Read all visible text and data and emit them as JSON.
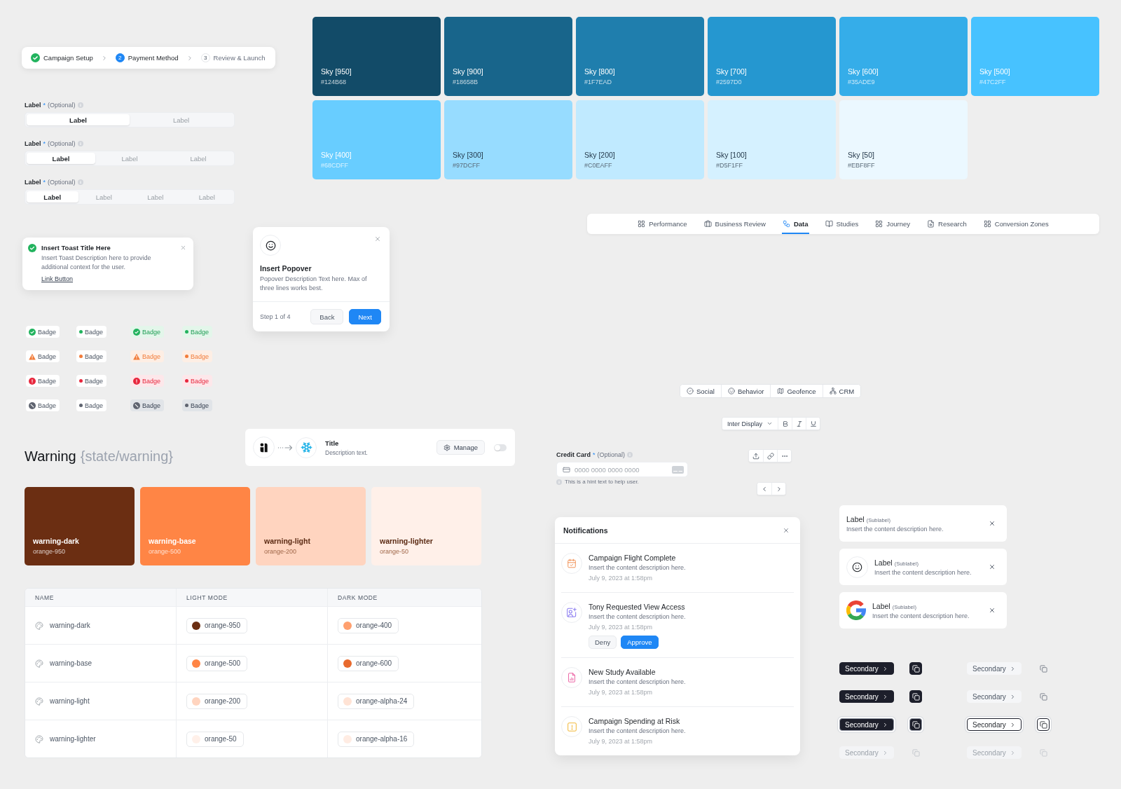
{
  "stepper": {
    "steps": [
      {
        "label": "Campaign Setup",
        "completed": true,
        "selected": false
      },
      {
        "number": "2",
        "label": "Payment Method",
        "completed": false,
        "selected": true
      },
      {
        "number": "3",
        "label": "Review & Launch",
        "completed": false,
        "selected": false
      }
    ]
  },
  "segmented_controls": [
    {
      "label": "Label",
      "required_mark": "*",
      "optional": "(Optional)",
      "options": [
        {
          "label": "Label",
          "selected": true
        },
        {
          "label": "Label",
          "selected": false
        }
      ]
    },
    {
      "label": "Label",
      "required_mark": "*",
      "optional": "(Optional)",
      "options": [
        {
          "label": "Label",
          "selected": true
        },
        {
          "label": "Label",
          "selected": false
        },
        {
          "label": "Label",
          "selected": false
        }
      ]
    },
    {
      "label": "Label",
      "required_mark": "*",
      "optional": "(Optional)",
      "options": [
        {
          "label": "Label",
          "selected": true
        },
        {
          "label": "Label",
          "selected": false
        },
        {
          "label": "Label",
          "selected": false
        },
        {
          "label": "Label",
          "selected": false
        }
      ]
    }
  ],
  "toast": {
    "kind": "success",
    "title": "Insert Toast Title Here",
    "description": "Insert Toast Description here to provide additional context for the user.",
    "link": "Link Button"
  },
  "popover": {
    "title": "Insert Popover",
    "description": "Popover Description Text here. Max of three lines works best.",
    "step": "Step 1 of 4",
    "buttons": [
      {
        "label": "Back",
        "kind": "secondary"
      },
      {
        "label": "Next",
        "kind": "primary"
      }
    ]
  },
  "badge_rows": [
    {
      "kind": "success",
      "badges": [
        {
          "label": "Badge",
          "kind": "icon",
          "tinted": false
        },
        {
          "label": "Badge",
          "kind": "dot",
          "tinted": false
        },
        {
          "label": "Badge",
          "kind": "icon",
          "tinted": true
        },
        {
          "label": "Badge",
          "kind": "dot",
          "tinted": true
        }
      ]
    },
    {
      "kind": "warning",
      "badges": [
        {
          "label": "Badge",
          "kind": "icon",
          "tinted": false
        },
        {
          "label": "Badge",
          "kind": "dot",
          "tinted": false
        },
        {
          "label": "Badge",
          "kind": "icon",
          "tinted": true
        },
        {
          "label": "Badge",
          "kind": "dot",
          "tinted": true
        }
      ]
    },
    {
      "kind": "error",
      "badges": [
        {
          "label": "Badge",
          "kind": "icon",
          "tinted": false
        },
        {
          "label": "Badge",
          "kind": "dot",
          "tinted": false
        },
        {
          "label": "Badge",
          "kind": "icon",
          "tinted": true
        },
        {
          "label": "Badge",
          "kind": "dot",
          "tinted": true
        }
      ]
    },
    {
      "kind": "neutral",
      "badges": [
        {
          "label": "Badge",
          "kind": "icon",
          "tinted": false
        },
        {
          "label": "Badge",
          "kind": "dot",
          "tinted": false
        },
        {
          "label": "Badge",
          "kind": "icon",
          "tinted": true
        },
        {
          "label": "Badge",
          "kind": "dot",
          "tinted": true
        }
      ]
    }
  ],
  "warning": {
    "title": "Warning",
    "token": "{state/warning}",
    "swatches": [
      {
        "name": "warning-dark",
        "token": "orange-950",
        "color": "#6b2e12"
      },
      {
        "name": "warning-base",
        "token": "orange-500",
        "color": "#ff8545"
      },
      {
        "name": "warning-light",
        "token": "orange-200",
        "color": "#ffd4bf"
      },
      {
        "name": "warning-lighter",
        "token": "orange-50",
        "color": "#fff0e9"
      }
    ],
    "table": {
      "columns": [
        "NAME",
        "LIGHT MODE",
        "DARK MODE"
      ],
      "rows": [
        {
          "name": "warning-dark",
          "light": {
            "token": "orange-950",
            "color": "#6b2e12"
          },
          "dark": {
            "token": "orange-400",
            "color": "#ffa06f"
          }
        },
        {
          "name": "warning-base",
          "light": {
            "token": "orange-500",
            "color": "#ff8545"
          },
          "dark": {
            "token": "orange-600",
            "color": "#e86a2e"
          }
        },
        {
          "name": "warning-light",
          "light": {
            "token": "orange-200",
            "color": "#ffd4bf"
          },
          "dark": {
            "token": "orange-alpha-24",
            "color": "#ffe3d5"
          }
        },
        {
          "name": "warning-lighter",
          "light": {
            "token": "orange-50",
            "color": "#fff0e9"
          },
          "dark": {
            "token": "orange-alpha-16",
            "color": "#ffece3"
          }
        }
      ]
    }
  },
  "integration_card": {
    "title": "Title",
    "description": "Description text.",
    "button": "Manage",
    "on": false
  },
  "sky_palette": [
    {
      "name": "Sky [950]",
      "hex": "#124B68",
      "color": "#124b68"
    },
    {
      "name": "Sky [900]",
      "hex": "#18658B",
      "color": "#18658b"
    },
    {
      "name": "Sky [800]",
      "hex": "#1F7EAD",
      "color": "#1f7ead"
    },
    {
      "name": "Sky [700]",
      "hex": "#2597D0",
      "color": "#2597d0"
    },
    {
      "name": "Sky [600]",
      "hex": "#35ADE9",
      "color": "#35ade9"
    },
    {
      "name": "Sky [500]",
      "hex": "#47C2FF",
      "color": "#47c2ff"
    },
    {
      "name": "Sky [400]",
      "hex": "#68CDFF",
      "color": "#68cdff"
    },
    {
      "name": "Sky [300]",
      "hex": "#97DCFF",
      "color": "#97dcff"
    },
    {
      "name": "Sky [200]",
      "hex": "#C0EAFF",
      "color": "#c0eaff"
    },
    {
      "name": "Sky [100]",
      "hex": "#D5F1FF",
      "color": "#d5f1ff"
    },
    {
      "name": "Sky [50]",
      "hex": "#EBF8FF",
      "color": "#ebf8ff"
    }
  ],
  "nav_tabs": [
    {
      "label": "Performance",
      "selected": false
    },
    {
      "label": "Business Review",
      "selected": false
    },
    {
      "label": "Data",
      "selected": true
    },
    {
      "label": "Studies",
      "selected": false
    },
    {
      "label": "Journey",
      "selected": false
    },
    {
      "label": "Research",
      "selected": false
    },
    {
      "label": "Conversion Zones",
      "selected": false
    }
  ],
  "filter_tabs": [
    {
      "label": "Social",
      "selected": false
    },
    {
      "label": "Behavior",
      "selected": false
    },
    {
      "label": "Geofence",
      "selected": false
    },
    {
      "label": "CRM",
      "selected": false
    }
  ],
  "text_toolbar": {
    "font": "Inter Display"
  },
  "credit_card_field": {
    "label": "Credit Card",
    "required_mark": "*",
    "optional": "(Optional)",
    "placeholder": "0000 0000 0000 0000",
    "hint": "This is a hint text to help user."
  },
  "notifications": {
    "title": "Notifications",
    "items": [
      {
        "title": "Campaign Flight Complete",
        "description": "Insert the content description here.",
        "time": "July 9, 2023 at 1:58pm"
      },
      {
        "title": "Tony Requested View Access",
        "description": "Insert the content description here.",
        "time": "July 9, 2023 at 1:58pm",
        "actions": [
          {
            "label": "Deny",
            "kind": "secondary"
          },
          {
            "label": "Approve",
            "kind": "primary"
          }
        ]
      },
      {
        "title": "New Study Available",
        "description": "Insert the content description here.",
        "time": "July 9, 2023 at 1:58pm"
      },
      {
        "title": "Campaign Spending at Risk",
        "description": "Insert the content description here.",
        "time": "July 9, 2023 at 1:58pm"
      }
    ]
  },
  "list_cards": [
    {
      "kind": "plain",
      "label": "Label",
      "sublabel": "(Sublabel)",
      "description": "Insert the content description here."
    },
    {
      "kind": "icon",
      "label": "Label",
      "sublabel": "(Sublabel)",
      "description": "Insert the content description here."
    },
    {
      "kind": "logo",
      "label": "Label",
      "sublabel": "(Sublabel)",
      "description": "Insert the content description here."
    }
  ],
  "button_rows": [
    {
      "solid_label": "Secondary",
      "subtle_label": "Secondary",
      "focused": false,
      "disabled": false
    },
    {
      "solid_label": "Secondary",
      "subtle_label": "Secondary",
      "focused": false,
      "disabled": false
    },
    {
      "solid_label": "Secondary",
      "subtle_label": "Secondary",
      "focused": true,
      "disabled": false
    },
    {
      "solid_label": "Secondary",
      "subtle_label": "Secondary",
      "focused": false,
      "disabled": true
    }
  ]
}
